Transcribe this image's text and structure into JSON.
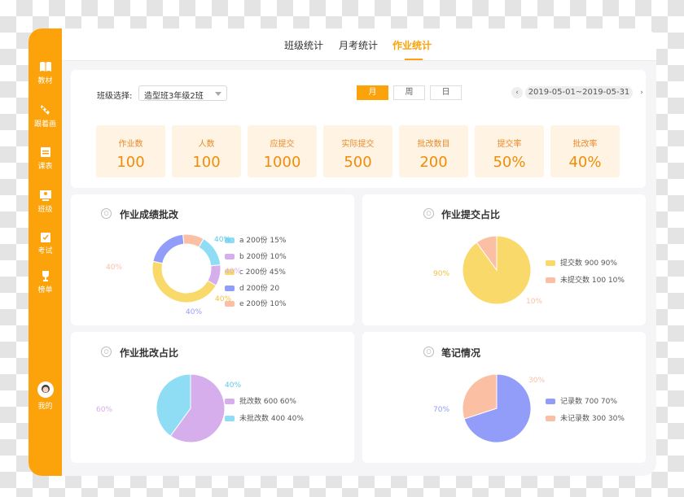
{
  "sidebar": {
    "items": [
      {
        "label": "教材",
        "icon": "book-icon"
      },
      {
        "label": "跟着画",
        "icon": "palette-icon"
      },
      {
        "label": "课表",
        "icon": "schedule-icon"
      },
      {
        "label": "班级",
        "icon": "class-icon"
      },
      {
        "label": "考试",
        "icon": "exam-icon"
      },
      {
        "label": "榜单",
        "icon": "trophy-icon"
      }
    ],
    "profile_label": "我的"
  },
  "tabs": [
    {
      "label": "班级统计"
    },
    {
      "label": "月考统计"
    },
    {
      "label": "作业统计",
      "active": true
    }
  ],
  "filter": {
    "class_label": "班级选择:",
    "class_value": "造型班3年级2班",
    "period_tabs": [
      "月",
      "周",
      "日"
    ],
    "active_period": "月",
    "date_range": "2019-05-01~2019-05-31",
    "prev_icon": "chevron-left-icon",
    "next_icon": "chevron-right-icon"
  },
  "stats": [
    {
      "label": "作业数",
      "value": "100"
    },
    {
      "label": "人数",
      "value": "100"
    },
    {
      "label": "应提交",
      "value": "1000"
    },
    {
      "label": "实际提交",
      "value": "500"
    },
    {
      "label": "批改数目",
      "value": "200"
    },
    {
      "label": "提交率",
      "value": "50%"
    },
    {
      "label": "批改率",
      "value": "40%"
    }
  ],
  "colors": {
    "accent": "#fca20a",
    "cyan": "#8fdcf5",
    "purple": "#d6aeec",
    "yellow": "#f8d96a",
    "blue": "#919df8",
    "salmon": "#fbbfa4"
  },
  "cards": [
    {
      "title": "作业成绩批改",
      "icon": "document-icon",
      "legend": [
        "a 200份  15%",
        "b 200份  10%",
        "c 200份  45%",
        "d 200份  20",
        "e 200份  10%"
      ],
      "labels": [
        "40%",
        "40%",
        "40%",
        "40%",
        "40%"
      ],
      "chart_data": {
        "type": "pie",
        "donut": true,
        "labels": [
          "a",
          "b",
          "c",
          "d",
          "e"
        ],
        "values": [
          15,
          10,
          45,
          20,
          10
        ],
        "colors": [
          "#8fdcf5",
          "#d6aeec",
          "#f8d96a",
          "#919df8",
          "#fbbfa4"
        ]
      }
    },
    {
      "title": "作业提交占比",
      "icon": "check-circle-icon",
      "legend": [
        "提交数  900  90%",
        "未提交数  100  10%"
      ],
      "labels": [
        "90%",
        "10%"
      ],
      "chart_data": {
        "type": "pie",
        "labels": [
          "提交数",
          "未提交数"
        ],
        "values": [
          90,
          10
        ],
        "colors": [
          "#f8d96a",
          "#fbbfa4"
        ]
      }
    },
    {
      "title": "作业批改占比",
      "icon": "pencil-icon",
      "legend": [
        "批改数  600  60%",
        "未批改数  400  40%"
      ],
      "labels": [
        "60%",
        "40%"
      ],
      "chart_data": {
        "type": "pie",
        "labels": [
          "批改数",
          "未批改数"
        ],
        "values": [
          60,
          40
        ],
        "colors": [
          "#d6aeec",
          "#8fdcf5"
        ]
      }
    },
    {
      "title": "笔记情况",
      "icon": "notebook-icon",
      "legend": [
        "记录数  700  70%",
        "未记录数  300  30%"
      ],
      "labels": [
        "70%",
        "30%"
      ],
      "chart_data": {
        "type": "pie",
        "labels": [
          "记录数",
          "未记录数"
        ],
        "values": [
          70,
          30
        ],
        "colors": [
          "#919df8",
          "#fbbfa4"
        ]
      }
    }
  ]
}
